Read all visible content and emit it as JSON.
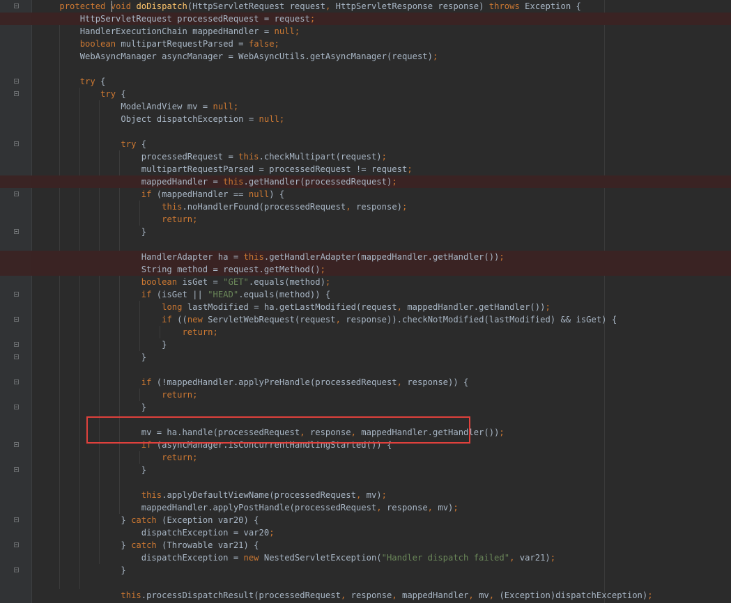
{
  "editor": {
    "theme_colors": {
      "background": "#2b2b2b",
      "gutter": "#313335",
      "keyword": "#cc7832",
      "string": "#6a8759",
      "method_declaration": "#ffc66d",
      "plain": "#a9b7c6",
      "breakpoint_line": "#3a2323",
      "highlight_box": "#e0413c"
    },
    "lines": [
      {
        "text": "    protected void doDispatch(HttpServletRequest request, HttpServletResponse response) throws Exception {"
      },
      {
        "text": "        HttpServletRequest processedRequest = request;",
        "breakpoint": true
      },
      {
        "text": "        HandlerExecutionChain mappedHandler = null;"
      },
      {
        "text": "        boolean multipartRequestParsed = false;"
      },
      {
        "text": "        WebAsyncManager asyncManager = WebAsyncUtils.getAsyncManager(request);"
      },
      {
        "text": ""
      },
      {
        "text": "        try {"
      },
      {
        "text": "            try {"
      },
      {
        "text": "                ModelAndView mv = null;"
      },
      {
        "text": "                Object dispatchException = null;"
      },
      {
        "text": ""
      },
      {
        "text": "                try {"
      },
      {
        "text": "                    processedRequest = this.checkMultipart(request);"
      },
      {
        "text": "                    multipartRequestParsed = processedRequest != request;"
      },
      {
        "text": "                    mappedHandler = this.getHandler(processedRequest);",
        "breakpoint": true
      },
      {
        "text": "                    if (mappedHandler == null) {"
      },
      {
        "text": "                        this.noHandlerFound(processedRequest, response);"
      },
      {
        "text": "                        return;"
      },
      {
        "text": "                    }"
      },
      {
        "text": ""
      },
      {
        "text": "                    HandlerAdapter ha = this.getHandlerAdapter(mappedHandler.getHandler());",
        "breakpoint": true
      },
      {
        "text": "                    String method = request.getMethod();",
        "breakpoint": true
      },
      {
        "text": "                    boolean isGet = \"GET\".equals(method);"
      },
      {
        "text": "                    if (isGet || \"HEAD\".equals(method)) {"
      },
      {
        "text": "                        long lastModified = ha.getLastModified(request, mappedHandler.getHandler());"
      },
      {
        "text": "                        if ((new ServletWebRequest(request, response)).checkNotModified(lastModified) && isGet) {"
      },
      {
        "text": "                            return;"
      },
      {
        "text": "                        }"
      },
      {
        "text": "                    }"
      },
      {
        "text": ""
      },
      {
        "text": "                    if (!mappedHandler.applyPreHandle(processedRequest, response)) {"
      },
      {
        "text": "                        return;"
      },
      {
        "text": "                    }"
      },
      {
        "text": ""
      },
      {
        "text": "                    mv = ha.handle(processedRequest, response, mappedHandler.getHandler());"
      },
      {
        "text": "                    if (asyncManager.isConcurrentHandlingStarted()) {"
      },
      {
        "text": "                        return;"
      },
      {
        "text": "                    }"
      },
      {
        "text": ""
      },
      {
        "text": "                    this.applyDefaultViewName(processedRequest, mv);"
      },
      {
        "text": "                    mappedHandler.applyPostHandle(processedRequest, response, mv);"
      },
      {
        "text": "                } catch (Exception var20) {"
      },
      {
        "text": "                    dispatchException = var20;"
      },
      {
        "text": "                } catch (Throwable var21) {"
      },
      {
        "text": "                    dispatchException = new NestedServletException(\"Handler dispatch failed\", var21);"
      },
      {
        "text": "                }"
      },
      {
        "text": ""
      },
      {
        "text": "                this.processDispatchResult(processedRequest, response, mappedHandler, mv, (Exception)dispatchException);"
      }
    ]
  }
}
